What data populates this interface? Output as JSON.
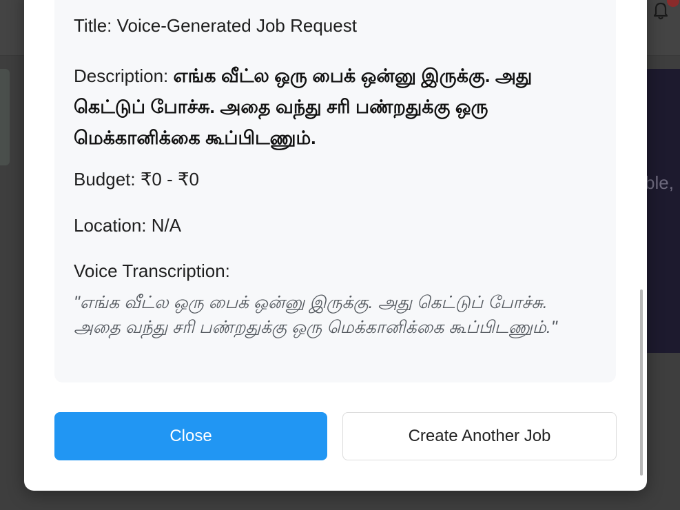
{
  "background": {
    "hero_text": "ble,"
  },
  "modal": {
    "title_label": "Title: ",
    "title_value": "Voice-Generated Job Request",
    "description_label": "Description: ",
    "description_value": "எங்க வீட்ல ஒரு பைக் ஒன்னு இருக்கு. அது கெட்டுப் போச்சு. அதை வந்து சரி பண்றதுக்கு ஒரு மெக்கானிக்கை கூப்பிடணும்.",
    "budget_label": "Budget: ",
    "budget_value": "₹0 - ₹0",
    "location_label": "Location: ",
    "location_value": "N/A",
    "transcription_label": "Voice Transcription:",
    "transcription_value": "\"எங்க வீட்ல ஒரு பைக் ஒன்னு இருக்கு. அது கெட்டுப் போச்சு. அதை வந்து சரி பண்றதுக்கு ஒரு மெக்கானிக்கை கூப்பிடணும்.\""
  },
  "buttons": {
    "close_label": "Close",
    "create_another_label": "Create Another Job"
  },
  "icons": {
    "bell": "bell-icon"
  },
  "colors": {
    "primary": "#2196f3",
    "panel_bg": "#f7f8fa",
    "overlay": "#3e3e3e"
  }
}
